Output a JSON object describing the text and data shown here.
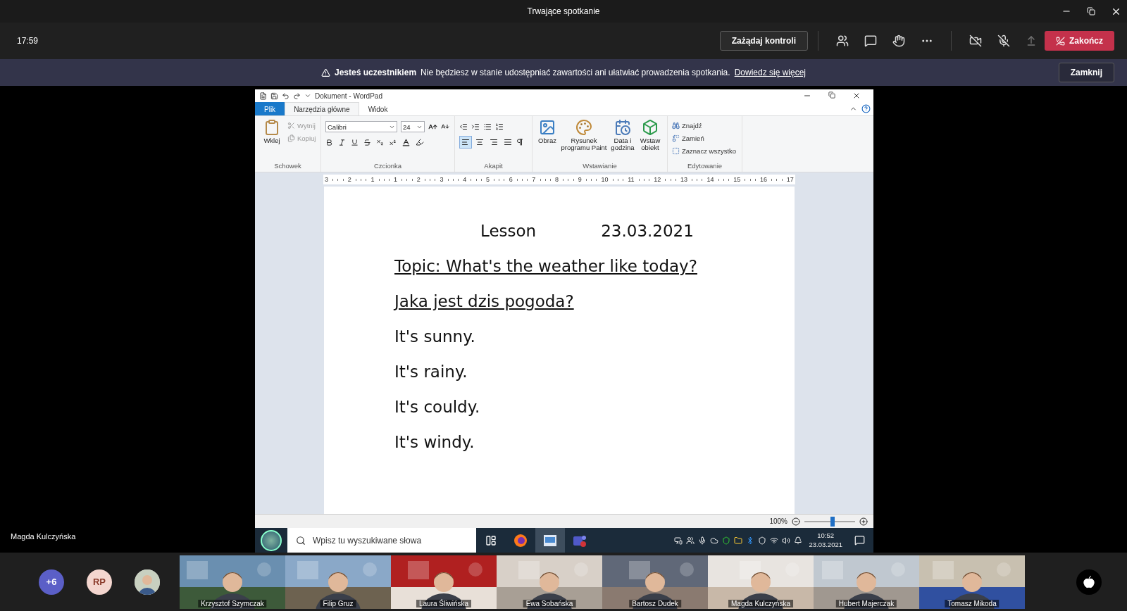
{
  "window": {
    "title": "Trwające spotkanie"
  },
  "toolbar": {
    "time": "17:59",
    "request_button": "Zażądaj kontroli",
    "camera_off": true,
    "mic_muted": true,
    "end_button": "Zakończ"
  },
  "banner": {
    "role": "Jesteś uczestnikiem",
    "message": "Nie będziesz w stanie udostępniać zawartości ani ułatwiać prowadzenia spotkania.",
    "link": "Dowiedz się więcej",
    "close_button": "Zamknij"
  },
  "shared_screen": {
    "presenter": "Magda Kulczyńska",
    "wordpad": {
      "title": "Dokument - WordPad",
      "tabs": [
        {
          "label": "Plik",
          "kind": "file",
          "selected": false
        },
        {
          "label": "Narzędzia główne",
          "kind": "tab",
          "selected": true
        },
        {
          "label": "Widok",
          "kind": "tab",
          "selected": false
        }
      ],
      "clipboard": {
        "paste": "Wklej",
        "cut": "Wytnij",
        "copy": "Kopiuj",
        "group": "Schowek"
      },
      "font": {
        "family": "Calibri",
        "size": "24",
        "group": "Czcionka"
      },
      "paragraph": {
        "alignment_buttons": [
          {
            "selected": true
          },
          {
            "selected": false
          },
          {
            "selected": false
          },
          {
            "selected": false
          }
        ],
        "group": "Akapit"
      },
      "insert": {
        "items": [
          "Obraz",
          "Rysunek programu Paint",
          "Data i godzina",
          "Wstaw obiekt"
        ],
        "group": "Wstawianie"
      },
      "editing": {
        "items": [
          "Znajdź",
          "Zamień",
          "Zaznacz wszystko"
        ],
        "group": "Edytowanie"
      },
      "ruler": [
        "3",
        "2",
        "1",
        "1",
        "2",
        "3",
        "4",
        "5",
        "6",
        "7",
        "8",
        "9",
        "10",
        "11",
        "12",
        "13",
        "14",
        "15",
        "16",
        "17"
      ],
      "document": [
        {
          "kind": "split",
          "parts": [
            "Lesson",
            "23.03.2021"
          ]
        },
        {
          "kind": "underlined",
          "text": "Topic: What's the weather like today?"
        },
        {
          "kind": "underlined",
          "text": "Jaka jest dzis pogoda?"
        },
        {
          "kind": "plain",
          "text": "It's sunny."
        },
        {
          "kind": "plain",
          "text": "It's rainy."
        },
        {
          "kind": "plain",
          "text": "It's couldy."
        },
        {
          "kind": "plain",
          "text": "It's windy."
        }
      ],
      "zoom": {
        "reading": "100%",
        "level": 0.55
      }
    },
    "taskbar": {
      "search_placeholder": "Wpisz tu wyszukiwane słowa",
      "time": "10:52",
      "date": "23.03.2021"
    }
  },
  "participants": {
    "overflow": "+6",
    "initials": "RP",
    "tiles": [
      {
        "name": "Krzysztof Szymczak"
      },
      {
        "name": "Filip Gruz"
      },
      {
        "name": "Laura Śliwińska"
      },
      {
        "name": "Ewa Sobańska"
      },
      {
        "name": "Bartosz Dudek"
      },
      {
        "name": "Magda Kulczyńska"
      },
      {
        "name": "Hubert Majerczak"
      },
      {
        "name": "Tomasz Mikoda"
      }
    ]
  }
}
